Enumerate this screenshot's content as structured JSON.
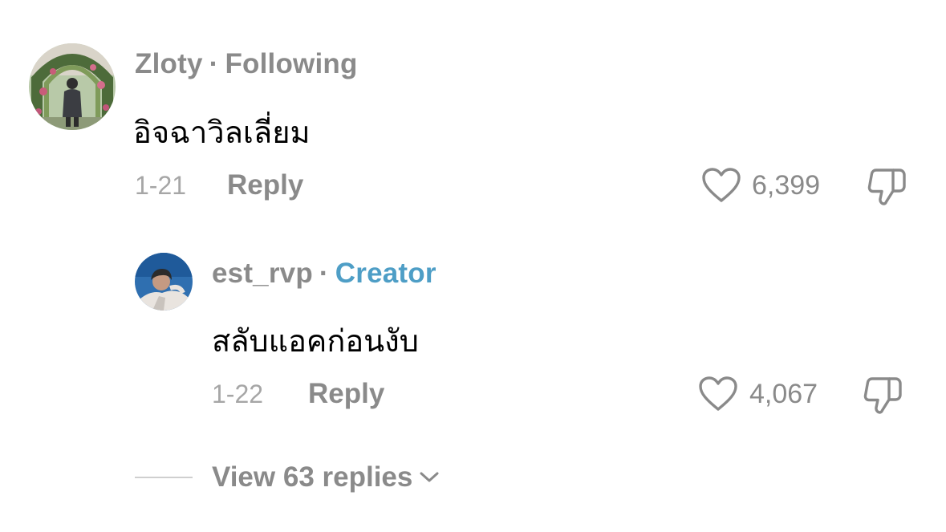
{
  "comments": [
    {
      "username": "Zloty",
      "separator": "·",
      "tag": "Following",
      "text": "อิจฉาวิลเลี่ยม",
      "date": "1-21",
      "reply_label": "Reply",
      "likes": "6,399",
      "avatar_icon": "user-avatar-garden-photo"
    },
    {
      "username": "est_rvp",
      "separator": "·",
      "tag": "Creator",
      "text": "สลับแอคก่อนงับ",
      "date": "1-22",
      "reply_label": "Reply",
      "likes": "4,067",
      "avatar_icon": "creator-avatar-sky-photo"
    }
  ],
  "view_replies": {
    "label": "View 63 replies"
  },
  "colors": {
    "muted_text": "#8a8a8a",
    "date_text": "#a6a6a6",
    "creator_accent": "#4e9ec6",
    "divider": "#cfcfcf"
  },
  "icons": {
    "like": "heart-outline-icon",
    "dislike": "thumbs-down-outline-icon",
    "expand": "chevron-down-icon"
  }
}
